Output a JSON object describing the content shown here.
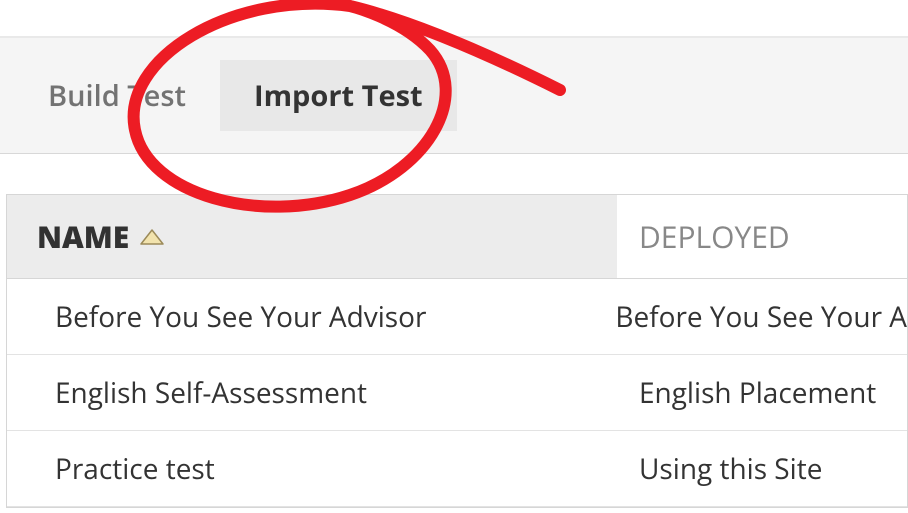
{
  "tabs": {
    "build": "Build Test",
    "import": "Import Test"
  },
  "table": {
    "headers": {
      "name": "NAME",
      "deployed": "DEPLOYED"
    },
    "rows": [
      {
        "name": "Before You See Your Advisor",
        "deployed": "Before You See Your A"
      },
      {
        "name": "English Self-Assessment",
        "deployed": "English Placement"
      },
      {
        "name": "Practice test",
        "deployed": "Using this Site"
      }
    ]
  }
}
